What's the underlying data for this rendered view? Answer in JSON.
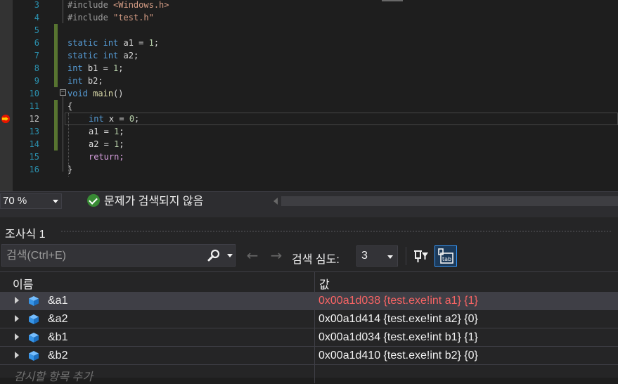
{
  "editor": {
    "lines": [
      {
        "num": "3",
        "code": "#include <Windows.h>"
      },
      {
        "num": "4",
        "code": "#include \"test.h\""
      },
      {
        "num": "5",
        "code": ""
      },
      {
        "num": "6",
        "code": "static int a1 = 1;"
      },
      {
        "num": "7",
        "code": "static int a2;"
      },
      {
        "num": "8",
        "code": "int b1 = 1;"
      },
      {
        "num": "9",
        "code": "int b2;"
      },
      {
        "num": "10",
        "code": "void main()"
      },
      {
        "num": "11",
        "code": "{"
      },
      {
        "num": "12",
        "code": "int x = 0;"
      },
      {
        "num": "13",
        "code": "a1 = 1;"
      },
      {
        "num": "14",
        "code": "a2 = 1;"
      },
      {
        "num": "15",
        "code": "return;"
      },
      {
        "num": "16",
        "code": "}"
      }
    ],
    "fold_glyph": "−"
  },
  "statusbar": {
    "zoom": "70 %",
    "issues": "문제가 검색되지 않음"
  },
  "watch": {
    "title": "조사식 1",
    "search_placeholder": "검색(Ctrl+E)",
    "back_arrow": "←",
    "forward_arrow": "→",
    "depth_label": "검색 심도:",
    "depth_value": "3",
    "col_name": "이름",
    "col_value": "값",
    "rows": [
      {
        "name": "&a1",
        "value": "0x00a1d038 {test.exe!int a1} {1}"
      },
      {
        "name": "&a2",
        "value": "0x00a1d414 {test.exe!int a2} {0}"
      },
      {
        "name": "&b1",
        "value": "0x00a1d034 {test.exe!int b1} {1}"
      },
      {
        "name": "&b2",
        "value": "0x00a1d410 {test.exe!int b2} {0}"
      }
    ],
    "add_item": "감시할 항목 추가"
  },
  "colors": {
    "accent": "#3399ff",
    "changed_value": "#f86464",
    "change_bar": "#577430",
    "breakpoint": "#e51400"
  }
}
